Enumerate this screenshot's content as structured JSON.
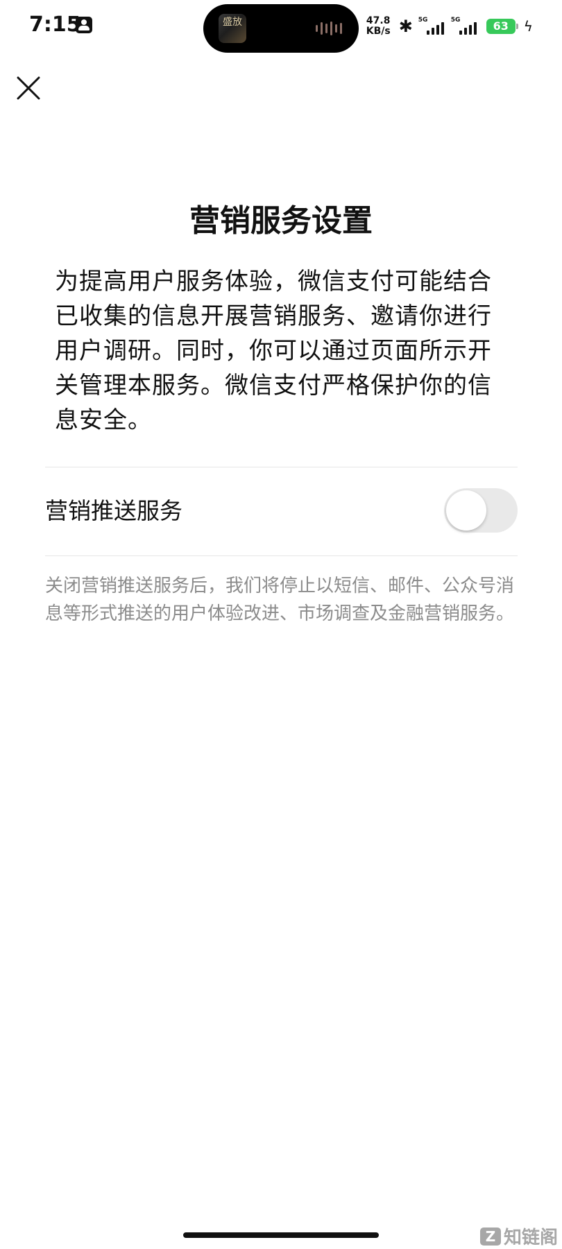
{
  "status_bar": {
    "time": "7:15",
    "network_speed_value": "47.8",
    "network_speed_unit": "KB/s",
    "signal_1_label": "5G",
    "signal_2_label": "5G",
    "battery_level": "63"
  },
  "now_playing": {
    "artwork_text": "盛放"
  },
  "page": {
    "title": "营销服务设置",
    "intro": "为提高用户服务体验，微信支付可能结合已收集的信息开展营销服务、邀请你进行用户调研。同时，你可以通过页面所示开关管理本服务。微信支付严格保护你的信息安全。"
  },
  "setting": {
    "label": "营销推送服务",
    "enabled": false
  },
  "footnote": {
    "text": "关闭营销推送服务后，我们将停止以短信、邮件、公众号消息等形式推送的用户体验改进、市场调查及金融营销服务。"
  },
  "watermark": {
    "badge": "Z",
    "text": "知链阁"
  },
  "colors": {
    "toggle_off": "#e9e9e9",
    "battery": "#37c95a",
    "footnote": "#8b8b8b"
  },
  "icons": {
    "close": "close-icon",
    "bluetooth": "bluetooth-icon",
    "charging": "charging-icon"
  }
}
